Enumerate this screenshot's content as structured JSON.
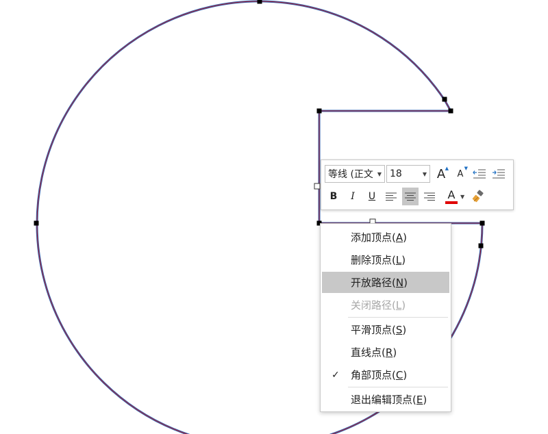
{
  "mini_toolbar": {
    "font_name": "等线 (正文",
    "font_size": "18",
    "grow_font_label": "A",
    "shrink_font_label": "A",
    "bold_label": "B",
    "italic_label": "I",
    "underline_label": "U",
    "font_color_label": "A",
    "font_color": "#e00000",
    "icons": [
      "decrease-indent-icon",
      "increase-indent-icon",
      "align-left-icon",
      "align-center-icon",
      "align-right-icon",
      "format-painter-icon"
    ]
  },
  "context_menu": {
    "items": [
      {
        "label": "添加顶点",
        "key": "A",
        "state": "normal"
      },
      {
        "label": "删除顶点",
        "key": "L",
        "state": "normal"
      },
      {
        "label": "开放路径",
        "key": "N",
        "state": "highlighted"
      },
      {
        "label": "关闭路径",
        "key": "L",
        "state": "disabled"
      },
      {
        "label": "平滑顶点",
        "key": "S",
        "state": "normal"
      },
      {
        "label": "直线点",
        "key": "R",
        "state": "normal"
      },
      {
        "label": "角部顶点",
        "key": "C",
        "state": "checked"
      },
      {
        "label": "退出编辑顶点",
        "key": "E",
        "state": "normal"
      }
    ]
  },
  "colors": {
    "path_blue": "#2f62b0",
    "path_red": "#b01e2a",
    "highlight": "#c8c8c8"
  }
}
